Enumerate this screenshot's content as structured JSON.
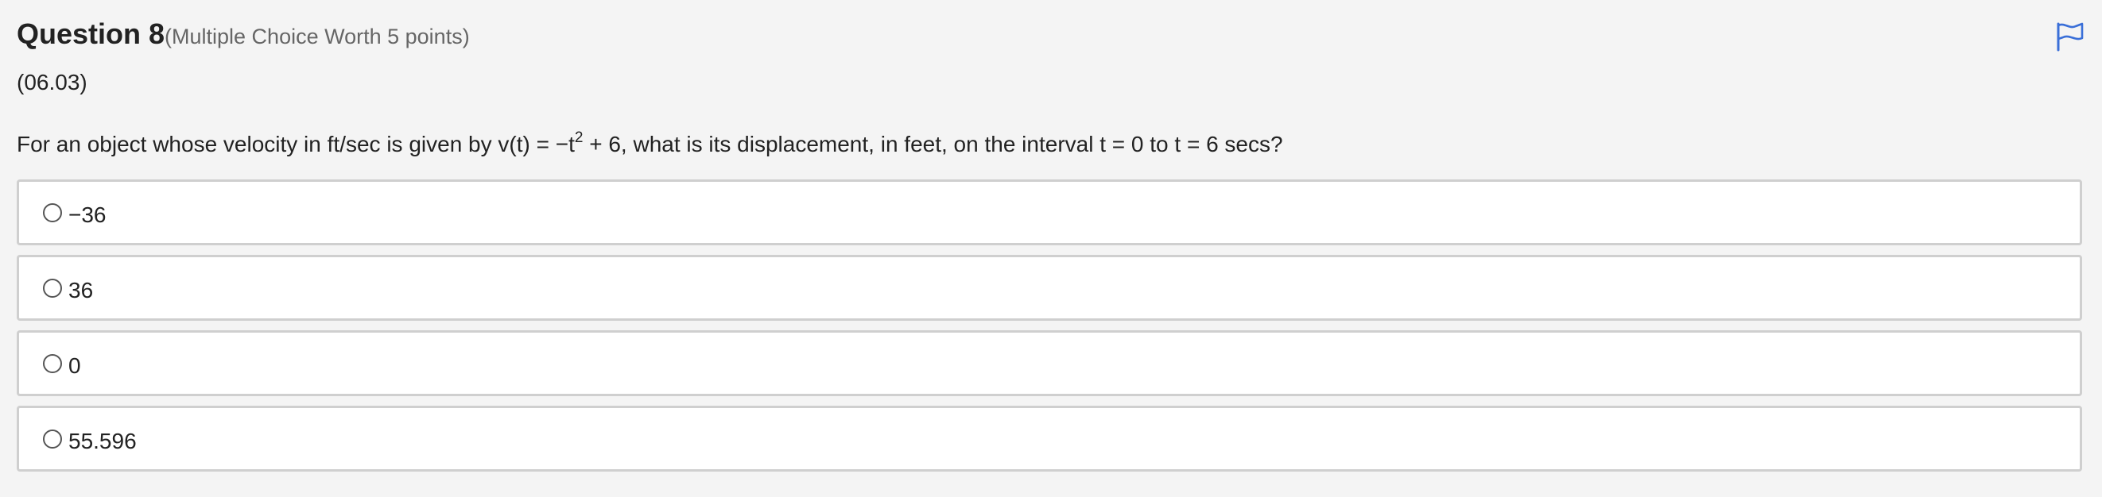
{
  "question": {
    "title": "Question 8",
    "worth": "(Multiple Choice Worth 5 points)",
    "code": "(06.03)",
    "prompt_before": "For an object whose velocity in ft/sec is given by v(t) = −t",
    "prompt_superscript": "2",
    "prompt_after": " + 6, what is its displacement, in feet, on the interval t = 0 to t = 6 secs?"
  },
  "flag": {
    "icon": "flag-icon",
    "color": "#3a6fd8"
  },
  "options": [
    {
      "label": "−36",
      "selected": false
    },
    {
      "label": "36",
      "selected": false
    },
    {
      "label": "0",
      "selected": false
    },
    {
      "label": "55.596",
      "selected": false
    }
  ]
}
